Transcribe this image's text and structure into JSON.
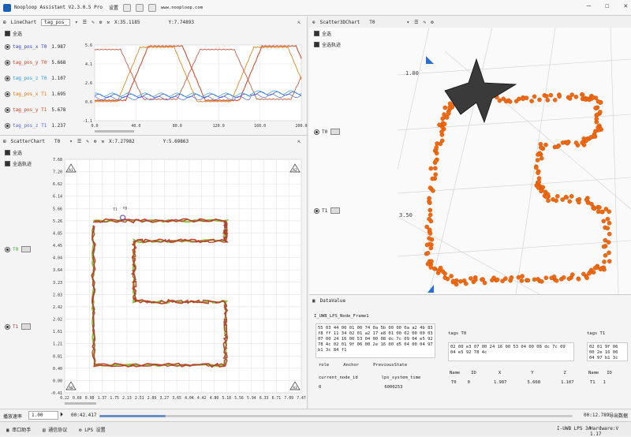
{
  "app": {
    "title": "Nooploop Assistant V2.3.0.5 Pro",
    "settings_label": "设置",
    "url": "www.nooploop.com"
  },
  "linechart": {
    "title": "LineChart",
    "selected_tag": "tag_pos_",
    "x_readout": "X:35.1185",
    "y_readout": "Y:7.74893",
    "select_all": "全选",
    "series": [
      {
        "name": "tag_pos_x T0",
        "value": "1.987",
        "color": "#3344cc"
      },
      {
        "name": "tag_pos_y T0",
        "value": "5.668",
        "color": "#d04020"
      },
      {
        "name": "tag_pos_z T0",
        "value": "1.107",
        "color": "#2a9adf"
      },
      {
        "name": "tag_pos_x T1",
        "value": "1.695",
        "color": "#e07800"
      },
      {
        "name": "tag_pos_y T1",
        "value": "5.678",
        "color": "#d04020"
      },
      {
        "name": "tag_pos_z T1",
        "value": "1.237",
        "color": "#5566dd"
      }
    ],
    "yticks": [
      "5.6",
      "4.1",
      "2.6",
      "0.6",
      "-1.1"
    ],
    "xticks": [
      "0.0",
      "40.0",
      "80.0",
      "120.0",
      "160.0",
      "200.0"
    ]
  },
  "scatterchart": {
    "title": "ScatterChart",
    "selected_tag": "T0",
    "x_readout": "X:7.27982",
    "y_readout": "Y:5.69863",
    "select_all": "全选",
    "select_all_track": "全选轨迹",
    "tags": [
      "T0",
      "T1"
    ],
    "yticks": [
      "7.68",
      "7.20",
      "6.62",
      "6.14",
      "5.66",
      "5.26",
      "4.85",
      "4.45",
      "4.04",
      "3.64",
      "3.23",
      "2.83",
      "2.42",
      "2.02",
      "1.61",
      "1.21",
      "0.81",
      "0.40",
      "0.00",
      "-0.41"
    ],
    "xticks": [
      "0.22",
      "0.60",
      "0.98",
      "1.37",
      "1.75",
      "2.13",
      "2.51",
      "2.89",
      "3.27",
      "3.65",
      "4.04",
      "4.42",
      "4.80",
      "5.18",
      "5.56",
      "5.94",
      "6.33",
      "6.71",
      "7.09",
      "7.47"
    ],
    "anchors": [
      "A1",
      "A2",
      "A0",
      "A3"
    ]
  },
  "scatter3d": {
    "title": "Scatter3DChart",
    "selected_tag": "T0",
    "select_all": "全选",
    "select_all_track": "全选轨迹",
    "tags": [
      "T0",
      "T1"
    ],
    "axis_labels": [
      "1.00",
      "3.50"
    ]
  },
  "datavalue": {
    "title": "DataValue",
    "frame_name": "I_UWB_LPS_Node_Frame1",
    "hex": "55 03 44 00 01 00 74 0a 5b 00 00 0a a2 4b 83 f8 ff 11 34 02 01 a2 17 e8 01 00 02 00 00 03 07 00 24 16 00 53 04 00 08 dc 7c 09 04 e5 92 78 4c 02 01 9f 06 00 2e 16 00 d5 04 00 04 97 b1 3c 84 f1",
    "role_headers": [
      "role",
      "Anchor",
      "PreviousState"
    ],
    "sys_headers": [
      "current_node_id",
      "lps_system_time"
    ],
    "sys_values": [
      "0",
      "6000253"
    ],
    "tag0_label": "tags T0",
    "tag0_hex": "02 00 e3 07 00 24 16 00 53 04 00 08 dc 7c 09 04 e5 92 78 4c",
    "tag1_label": "tags T1",
    "tag1_hex": "02 01 9f 06 00 2e 16 00 04 97 b1 3c 84 f1",
    "table_headers": [
      "Name",
      "ID",
      "X",
      "Y",
      "Z"
    ],
    "tag0_row": [
      "T0",
      "0",
      "1.987",
      "5.668",
      "1.107"
    ],
    "tag1_row": [
      "T1",
      "1"
    ]
  },
  "playback": {
    "speed_label": "播放速率",
    "speed_value": "1.00",
    "start_time": "00:42.417",
    "end_time": "00:12.789",
    "export_label": "导出数据",
    "progress": 0.14
  },
  "statusbar": {
    "serial": "串口助手",
    "protocol": "通信协议",
    "lps": "LPS 设置",
    "product": "I-UWB LPS 3A",
    "hardware": "Hardware:V 1.17"
  }
}
